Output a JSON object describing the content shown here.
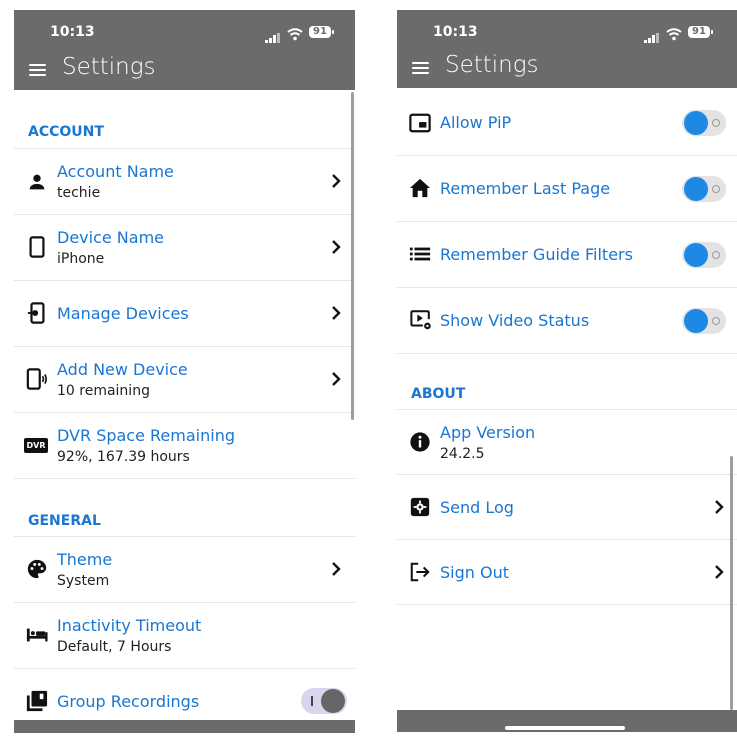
{
  "status_bar": {
    "time": "10:13",
    "battery": "91"
  },
  "header": {
    "title": "Settings"
  },
  "left_screen": {
    "section_account": "ACCOUNT",
    "account_name": {
      "label": "Account Name",
      "value": "techie"
    },
    "device_name": {
      "label": "Device Name",
      "value": "iPhone"
    },
    "manage_devices": {
      "label": "Manage Devices"
    },
    "add_new_device": {
      "label": "Add New Device",
      "value": "10 remaining"
    },
    "dvr_space": {
      "label": "DVR Space Remaining",
      "value": "92%, 167.39 hours",
      "icon_text": "DVR"
    },
    "section_general": "GENERAL",
    "theme": {
      "label": "Theme",
      "value": "System"
    },
    "inactivity_timeout": {
      "label": "Inactivity Timeout",
      "value": "Default, 7 Hours"
    },
    "group_recordings": {
      "label": "Group Recordings",
      "enabled": false
    }
  },
  "right_screen": {
    "allow_pip": {
      "label": "Allow PiP",
      "enabled": true
    },
    "remember_last_page": {
      "label": "Remember Last Page",
      "enabled": true
    },
    "remember_guide_filters": {
      "label": "Remember Guide Filters",
      "enabled": true
    },
    "show_video_status": {
      "label": "Show Video Status",
      "enabled": true
    },
    "section_about": "ABOUT",
    "app_version": {
      "label": "App Version",
      "value": "24.2.5"
    },
    "send_log": {
      "label": "Send Log"
    },
    "sign_out": {
      "label": "Sign Out"
    }
  },
  "colors": {
    "header": "#6b6b6b",
    "accent": "#1976d2",
    "toggle_on": "#1e88e5"
  }
}
